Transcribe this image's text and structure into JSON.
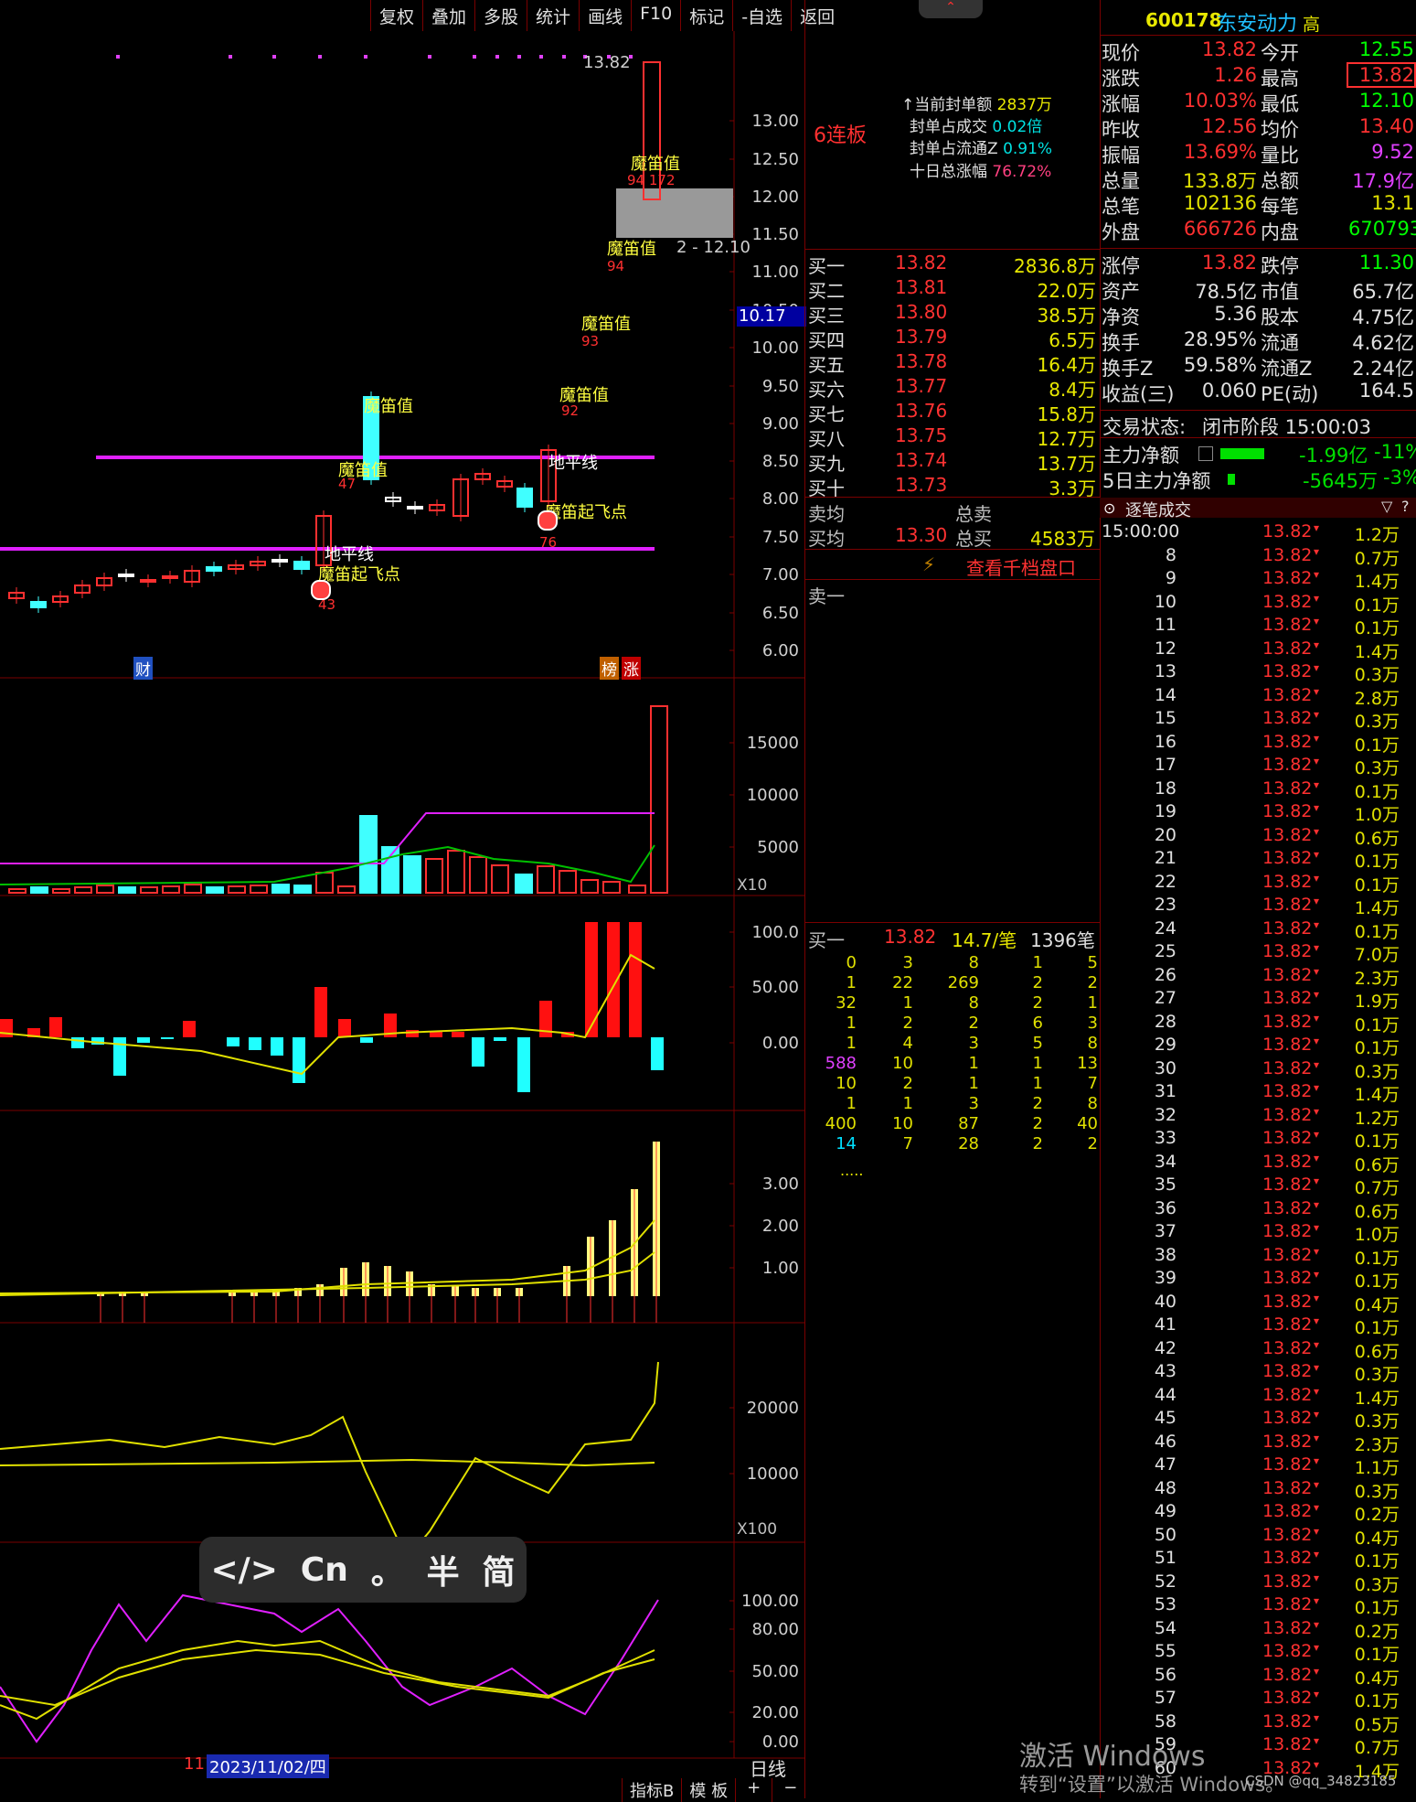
{
  "toolbar": {
    "items": [
      "复权",
      "叠加",
      "多股",
      "统计",
      "画线",
      "F10",
      "标记",
      "-自选",
      "返回"
    ]
  },
  "chart": {
    "price_axis": [
      "13.00",
      "12.50",
      "12.00",
      "11.50",
      "11.00",
      "10.50",
      "10.00",
      "9.50",
      "9.00",
      "8.50",
      "8.00",
      "7.50",
      "7.00",
      "6.50",
      "6.00"
    ],
    "current_price_tag": "10.17",
    "high_label": "13.82",
    "range_label": "2 - 12.10",
    "lianban": "6连板",
    "signal_labels": [
      {
        "text": "魔笛值",
        "sub": "94 172"
      },
      {
        "text": "魔笛值",
        "sub": "94"
      },
      {
        "text": "魔笛值",
        "sub": "93"
      },
      {
        "text": "魔笛值",
        "sub": "92"
      },
      {
        "text": "魔笛值",
        "sub": "47"
      },
      {
        "text": "魔笛值",
        "sub": ""
      }
    ],
    "dipingxian_labels": [
      "地平线",
      "地平线"
    ],
    "takeoff_labels": [
      {
        "text": "魔笛起飞点",
        "num": "76"
      },
      {
        "text": "魔笛起飞点",
        "num": "43"
      }
    ],
    "badges": {
      "cai": "财",
      "bang": "榜",
      "zhang": "涨"
    },
    "vol_axis": [
      "15000",
      "10000",
      "5000"
    ],
    "vol_mult": "X10",
    "macd_axis": [
      "100.0",
      "50.00",
      "0.00"
    ],
    "ind3_axis": [
      "3.00",
      "2.00",
      "1.00"
    ],
    "ind4_axis": [
      "20000",
      "10000"
    ],
    "ind4_mult": "X100",
    "kdj_axis": [
      "100.00",
      "80.00",
      "50.00",
      "20.00",
      "0.00"
    ],
    "date_label": "2023/11/02/四",
    "date_prefix": "11",
    "period": "日线",
    "bottom_tabs": [
      "指标B",
      "模 板",
      "+",
      "−"
    ]
  },
  "seal": {
    "amount_label": "当前封单额",
    "amount": "2837万",
    "deal_label": "封单占成交",
    "deal": "0.02倍",
    "float_label": "封单占流通Z",
    "float": "0.91%",
    "tenday_label": "十日总涨幅",
    "tenday": "76.72%"
  },
  "bids": [
    {
      "label": "买一",
      "price": "13.82",
      "vol": "2836.8万"
    },
    {
      "label": "买二",
      "price": "13.81",
      "vol": "22.0万"
    },
    {
      "label": "买三",
      "price": "13.80",
      "vol": "38.5万"
    },
    {
      "label": "买四",
      "price": "13.79",
      "vol": "6.5万"
    },
    {
      "label": "买五",
      "price": "13.78",
      "vol": "16.4万"
    },
    {
      "label": "买六",
      "price": "13.77",
      "vol": "8.4万"
    },
    {
      "label": "买七",
      "price": "13.76",
      "vol": "15.8万"
    },
    {
      "label": "买八",
      "price": "13.75",
      "vol": "12.7万"
    },
    {
      "label": "买九",
      "price": "13.74",
      "vol": "13.7万"
    },
    {
      "label": "买十",
      "price": "13.73",
      "vol": "3.3万"
    }
  ],
  "sell_avg_label": "卖均",
  "sell_total_label": "总卖",
  "buy_avg_label": "买均",
  "buy_avg": "13.30",
  "buy_total_label": "总买",
  "buy_total": "4583万",
  "qiandang_label": "查看千档盘口",
  "sell1_label": "卖一",
  "queue": {
    "label": "买一",
    "price": "13.82",
    "per": "14.7/笔",
    "count": "1396笔",
    "rows": [
      [
        "0",
        "3",
        "8",
        "1",
        "5"
      ],
      [
        "1",
        "22",
        "269",
        "2",
        "2"
      ],
      [
        "32",
        "1",
        "8",
        "2",
        "1"
      ],
      [
        "1",
        "2",
        "2",
        "6",
        "3"
      ],
      [
        "1",
        "4",
        "3",
        "5",
        "8"
      ],
      [
        "588",
        "10",
        "1",
        "1",
        "13"
      ],
      [
        "10",
        "2",
        "1",
        "1",
        "7"
      ],
      [
        "1",
        "1",
        "3",
        "2",
        "8"
      ],
      [
        "400",
        "10",
        "87",
        "2",
        "40"
      ],
      [
        "14",
        "7",
        "28",
        "2",
        "2"
      ]
    ],
    "more": "....."
  },
  "stock": {
    "code": "600178",
    "name": "东安动力",
    "tag": "高"
  },
  "quote_left": [
    {
      "k": "现价",
      "v": "13.82"
    },
    {
      "k": "涨跌",
      "v": "1.26"
    },
    {
      "k": "涨幅",
      "v": "10.03%"
    },
    {
      "k": "昨收",
      "v": "12.56"
    },
    {
      "k": "振幅",
      "v": "13.69%"
    },
    {
      "k": "总量",
      "v": "133.8万"
    },
    {
      "k": "总笔",
      "v": "102136"
    },
    {
      "k": "外盘",
      "v": "666726"
    }
  ],
  "quote_right": [
    {
      "k": "今开",
      "v": "12.55"
    },
    {
      "k": "最高",
      "v": "13.82"
    },
    {
      "k": "最低",
      "v": "12.10"
    },
    {
      "k": "均价",
      "v": "13.40"
    },
    {
      "k": "量比",
      "v": "9.52"
    },
    {
      "k": "总额",
      "v": "17.9亿"
    },
    {
      "k": "每笔",
      "v": "13.1"
    },
    {
      "k": "内盘",
      "v": "670793"
    }
  ],
  "fund_left": [
    {
      "k": "涨停",
      "v": "13.82"
    },
    {
      "k": "资产",
      "v": "78.5亿"
    },
    {
      "k": "净资",
      "v": "5.36"
    },
    {
      "k": "换手",
      "v": "28.95%"
    },
    {
      "k": "换手Z",
      "v": "59.58%"
    },
    {
      "k": "收益(三)",
      "v": "0.060"
    }
  ],
  "fund_right": [
    {
      "k": "跌停",
      "v": "11.30"
    },
    {
      "k": "市值",
      "v": "65.7亿"
    },
    {
      "k": "股本",
      "v": "4.75亿"
    },
    {
      "k": "流通",
      "v": "4.62亿"
    },
    {
      "k": "流通Z",
      "v": "2.24亿"
    },
    {
      "k": "PE(动)",
      "v": "164.5"
    }
  ],
  "trade_status": {
    "label": "交易状态:",
    "value": "闭市阶段 15:00:03"
  },
  "main_net": {
    "label": "主力净额",
    "value": "-1.99亿",
    "pct": "-11%"
  },
  "main_net5": {
    "label": "5日主力净额",
    "value": "-5645万",
    "pct": "-3%"
  },
  "ticks_title": "逐笔成交",
  "ticks_first_time": "15:00:00",
  "ticks": [
    {
      "t": "15:00:00",
      "p": "13.82",
      "v": "1.2万"
    },
    {
      "t": "8",
      "p": "13.82",
      "v": "0.7万"
    },
    {
      "t": "9",
      "p": "13.82",
      "v": "1.4万"
    },
    {
      "t": "10",
      "p": "13.82",
      "v": "0.1万"
    },
    {
      "t": "11",
      "p": "13.82",
      "v": "0.1万"
    },
    {
      "t": "12",
      "p": "13.82",
      "v": "1.4万"
    },
    {
      "t": "13",
      "p": "13.82",
      "v": "0.3万"
    },
    {
      "t": "14",
      "p": "13.82",
      "v": "2.8万"
    },
    {
      "t": "15",
      "p": "13.82",
      "v": "0.3万"
    },
    {
      "t": "16",
      "p": "13.82",
      "v": "0.1万"
    },
    {
      "t": "17",
      "p": "13.82",
      "v": "0.3万"
    },
    {
      "t": "18",
      "p": "13.82",
      "v": "0.1万"
    },
    {
      "t": "19",
      "p": "13.82",
      "v": "1.0万"
    },
    {
      "t": "20",
      "p": "13.82",
      "v": "0.6万"
    },
    {
      "t": "21",
      "p": "13.82",
      "v": "0.1万"
    },
    {
      "t": "22",
      "p": "13.82",
      "v": "0.1万"
    },
    {
      "t": "23",
      "p": "13.82",
      "v": "1.4万"
    },
    {
      "t": "24",
      "p": "13.82",
      "v": "0.1万"
    },
    {
      "t": "25",
      "p": "13.82",
      "v": "7.0万"
    },
    {
      "t": "26",
      "p": "13.82",
      "v": "2.3万"
    },
    {
      "t": "27",
      "p": "13.82",
      "v": "1.9万"
    },
    {
      "t": "28",
      "p": "13.82",
      "v": "0.1万"
    },
    {
      "t": "29",
      "p": "13.82",
      "v": "0.1万"
    },
    {
      "t": "30",
      "p": "13.82",
      "v": "0.3万"
    },
    {
      "t": "31",
      "p": "13.82",
      "v": "1.4万"
    },
    {
      "t": "32",
      "p": "13.82",
      "v": "1.2万"
    },
    {
      "t": "33",
      "p": "13.82",
      "v": "0.1万"
    },
    {
      "t": "34",
      "p": "13.82",
      "v": "0.6万"
    },
    {
      "t": "35",
      "p": "13.82",
      "v": "0.7万"
    },
    {
      "t": "36",
      "p": "13.82",
      "v": "0.6万"
    },
    {
      "t": "37",
      "p": "13.82",
      "v": "1.0万"
    },
    {
      "t": "38",
      "p": "13.82",
      "v": "0.1万"
    },
    {
      "t": "39",
      "p": "13.82",
      "v": "0.1万"
    },
    {
      "t": "40",
      "p": "13.82",
      "v": "0.4万"
    },
    {
      "t": "41",
      "p": "13.82",
      "v": "0.1万"
    },
    {
      "t": "42",
      "p": "13.82",
      "v": "0.6万"
    },
    {
      "t": "43",
      "p": "13.82",
      "v": "0.3万"
    },
    {
      "t": "44",
      "p": "13.82",
      "v": "1.4万"
    },
    {
      "t": "45",
      "p": "13.82",
      "v": "0.3万"
    },
    {
      "t": "46",
      "p": "13.82",
      "v": "2.3万"
    },
    {
      "t": "47",
      "p": "13.82",
      "v": "1.1万"
    },
    {
      "t": "48",
      "p": "13.82",
      "v": "0.3万"
    },
    {
      "t": "49",
      "p": "13.82",
      "v": "0.2万"
    },
    {
      "t": "50",
      "p": "13.82",
      "v": "0.4万"
    },
    {
      "t": "51",
      "p": "13.82",
      "v": "0.1万"
    },
    {
      "t": "52",
      "p": "13.82",
      "v": "0.3万"
    },
    {
      "t": "53",
      "p": "13.82",
      "v": "0.1万"
    },
    {
      "t": "54",
      "p": "13.82",
      "v": "0.2万"
    },
    {
      "t": "55",
      "p": "13.82",
      "v": "0.1万"
    },
    {
      "t": "56",
      "p": "13.82",
      "v": "0.4万"
    },
    {
      "t": "57",
      "p": "13.82",
      "v": "0.1万"
    },
    {
      "t": "58",
      "p": "13.82",
      "v": "0.5万"
    },
    {
      "t": "59",
      "p": "13.82",
      "v": "0.7万"
    },
    {
      "t": "60",
      "p": "13.82",
      "v": "1.4万"
    }
  ],
  "ime": {
    "code": "</>",
    "cn": "Cn",
    "dot": "。",
    "half": "半",
    "simp": "简"
  },
  "watermark": {
    "line1": "激活 Windows",
    "line2": "转到“设置”以激活 Windows。"
  },
  "csdn": "CSDN @qq_34823185"
}
